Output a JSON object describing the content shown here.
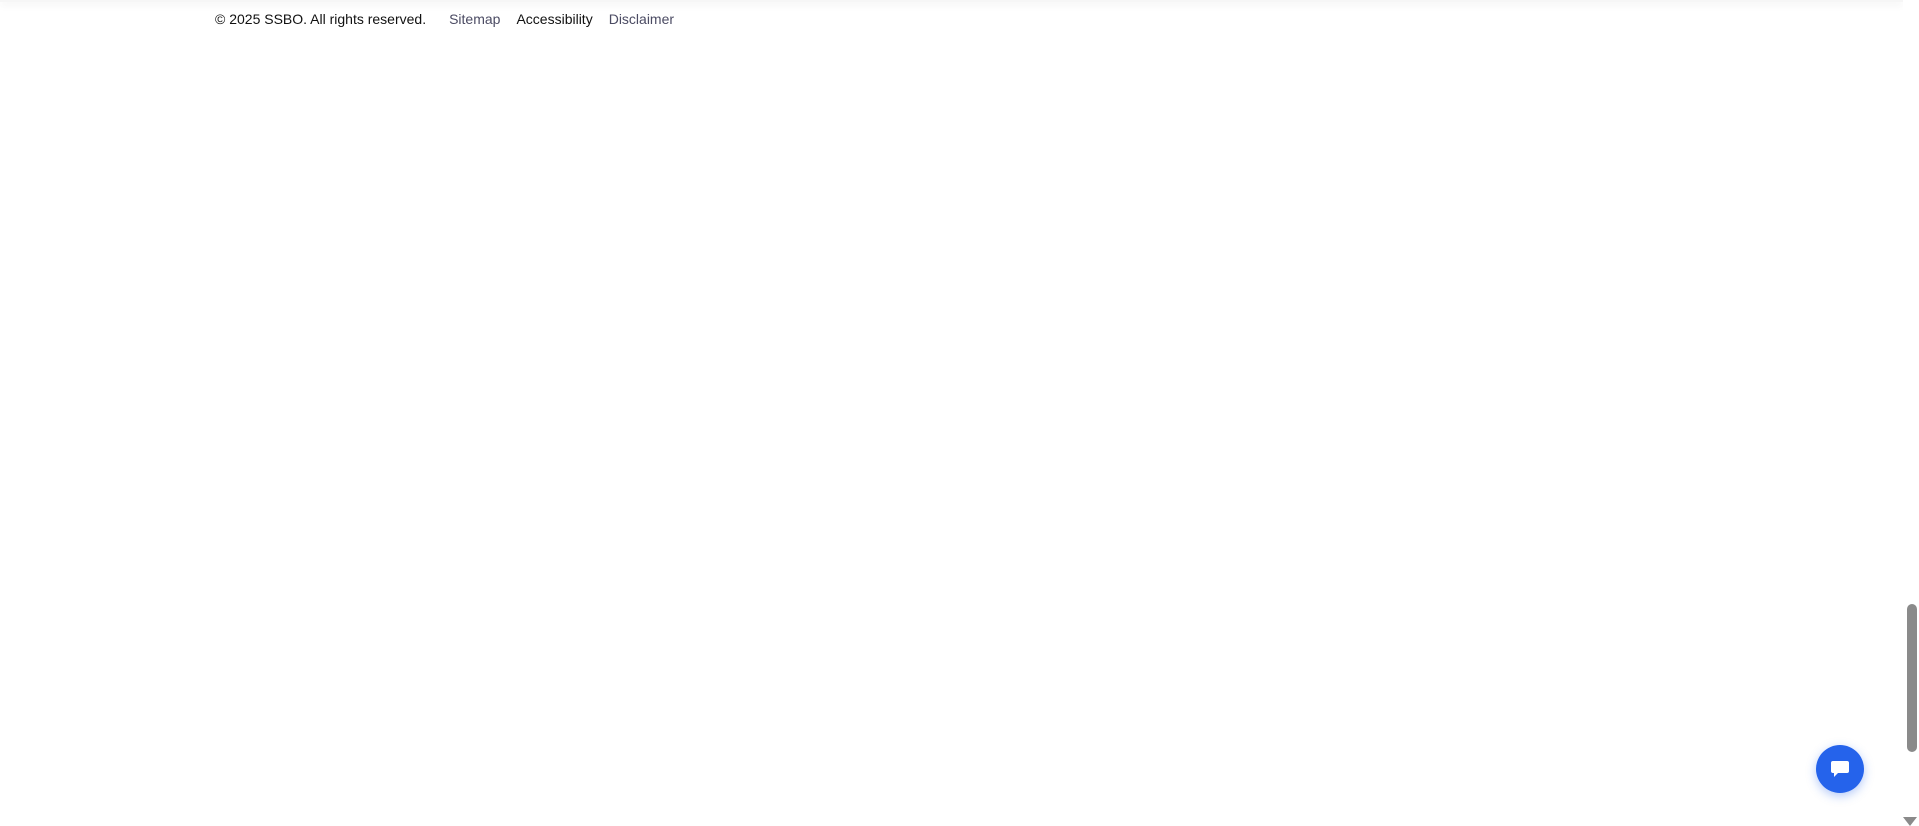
{
  "footer": {
    "copyright": "© 2025 SSBO. All rights reserved.",
    "links": [
      {
        "label": "Sitemap",
        "color": "#4b4b63"
      },
      {
        "label": "Accessibility",
        "color": "#111111"
      },
      {
        "label": "Disclaimer",
        "color": "#4b4b63"
      }
    ]
  },
  "chat_button": {
    "icon": "chat-bubble-icon",
    "color": "#2563eb"
  },
  "scrollbar": {
    "thumb_color": "#8a8a8a"
  }
}
